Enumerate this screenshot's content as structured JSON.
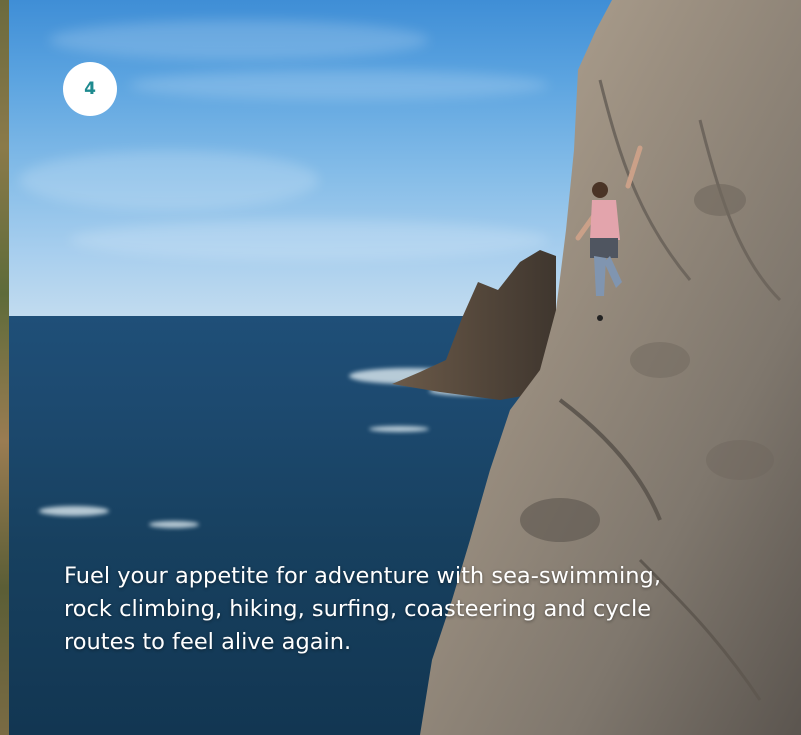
{
  "badge": {
    "number": "4"
  },
  "caption": {
    "line1": "Fuel your appetite for adventure with sea-swimming,",
    "line2": "rock climbing, hiking, surfing, coasteering and cycle",
    "line3": "routes to feel alive again."
  },
  "colors": {
    "badge_text": "#1e8a8f",
    "sky": "#5ca4e0",
    "sea": "#1d4a70",
    "rock": "#8f8579"
  },
  "photo": {
    "subject": "rock-climber-on-sea-cliff"
  }
}
